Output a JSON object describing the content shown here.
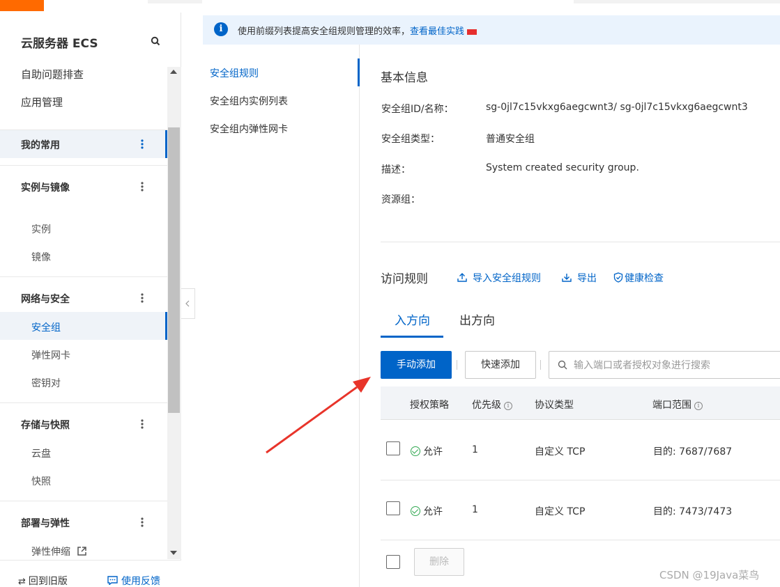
{
  "sidebar": {
    "title": "云服务器 ECS",
    "top_items": [
      "自助问题排查",
      "应用管理"
    ],
    "groups": [
      {
        "label": "我的常用",
        "items": []
      },
      {
        "label": "实例与镜像",
        "items": [
          "实例",
          "镜像"
        ]
      },
      {
        "label": "网络与安全",
        "items": [
          "安全组",
          "弹性网卡",
          "密钥对"
        ]
      },
      {
        "label": "存储与快照",
        "items": [
          "云盘",
          "快照"
        ]
      },
      {
        "label": "部署与弹性",
        "items": [
          "弹性伸缩"
        ]
      }
    ],
    "active_item": "安全组",
    "footer": {
      "back": "回到旧版",
      "feedback": "使用反馈"
    }
  },
  "notice": {
    "text": "使用前缀列表提高安全组规则管理的效率，",
    "link": "查看最佳实践"
  },
  "subnav": [
    "安全组规则",
    "安全组内实例列表",
    "安全组内弹性网卡"
  ],
  "basic_info": {
    "title": "基本信息",
    "rows": [
      {
        "key": "安全组ID/名称：",
        "value": "sg-0jl7c15vkxg6aegcwnt3/ sg-0jl7c15vkxg6aegcwnt3"
      },
      {
        "key": "安全组类型：",
        "value": "普通安全组"
      },
      {
        "key": "描述：",
        "value": "System created security group."
      },
      {
        "key": "资源组：",
        "value": ""
      }
    ]
  },
  "access_rules": {
    "title": "访问规则",
    "actions": [
      "导入安全组规则",
      "导出",
      "健康检查"
    ],
    "tabs": [
      "入方向",
      "出方向"
    ],
    "active_tab": "入方向",
    "add_manual": "手动添加",
    "add_quick": "快速添加",
    "search_placeholder": "输入端口或者授权对象进行搜索",
    "columns": [
      "授权策略",
      "优先级",
      "协议类型",
      "端口范围"
    ],
    "rows": [
      {
        "policy": "允许",
        "priority": "1",
        "protocol": "自定义 TCP",
        "port": "目的: 7687/7687"
      },
      {
        "policy": "允许",
        "priority": "1",
        "protocol": "自定义 TCP",
        "port": "目的: 7473/7473"
      }
    ],
    "delete": "删除"
  },
  "watermark": "CSDN @19Java菜鸟",
  "colors": {
    "accent": "#0064c8",
    "brand": "#ff6a00",
    "arrow": "#e8342a",
    "allow": "#32a852"
  }
}
